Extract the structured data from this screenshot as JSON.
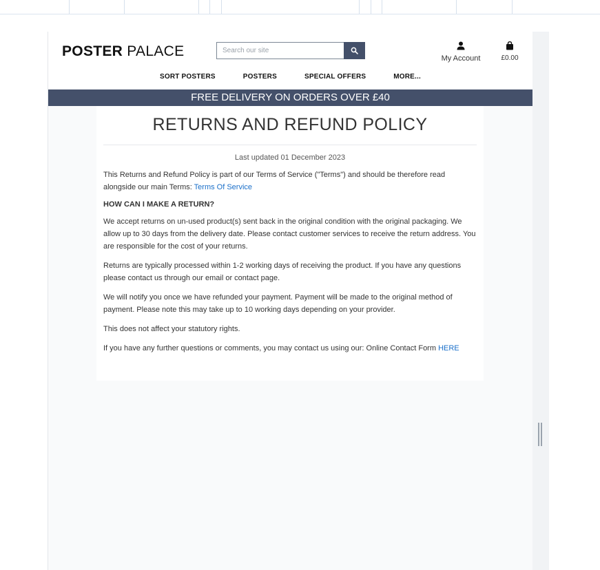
{
  "brand": {
    "name_bold": "POSTER",
    "name_light": "PALACE"
  },
  "search": {
    "placeholder": "Search our site",
    "value": ""
  },
  "account": {
    "label": "My Account"
  },
  "basket": {
    "total": "£0.00"
  },
  "nav": {
    "items": [
      {
        "label": "SORT POSTERS"
      },
      {
        "label": "POSTERS"
      },
      {
        "label": "SPECIAL OFFERS"
      },
      {
        "label": "MORE..."
      }
    ]
  },
  "banner": {
    "text": "FREE DELIVERY ON ORDERS OVER £40"
  },
  "colors": {
    "brand_dark": "#44506a",
    "link": "#1a6fc9"
  },
  "page": {
    "title": "RETURNS AND REFUND POLICY",
    "updated": "Last updated 01 December 2023",
    "intro": "This Returns and Refund Policy is part of our Terms of Service (\"Terms\") and should be therefore read alongside our main Terms: ",
    "intro_link": "Terms Of Service",
    "heading": "HOW CAN I MAKE A RETURN?",
    "p1": "We accept returns on un-used product(s) sent back in the original condition with the original packaging. We allow up to 30 days from the delivery date. Please contact customer services to receive the return address. You are responsible for the cost of your returns.",
    "p2": "Returns are typically processed within 1-2 working days of receiving the product. If you have any questions please contact us through our email or contact page.",
    "p3": "We will notify you once we have refunded your payment. Payment will be made to the original method of payment. Please note this may take up to 10 working days depending on your provider.",
    "p4": "This does not affect your statutory rights.",
    "contact": "If you have any further questions or comments, you may contact us using our: Online Contact Form ",
    "contact_link": "HERE"
  }
}
